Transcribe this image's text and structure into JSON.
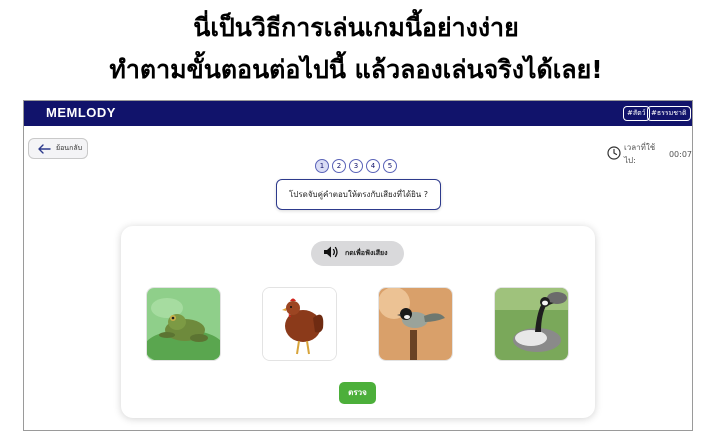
{
  "headline": {
    "line1": "นี่เป็นวิธีการเล่นเกมนี้อย่างง่าย",
    "line2": "ทำตามขั้นตอนต่อไปนี้ แล้วลองเล่นจริงได้เลย!"
  },
  "app": {
    "logo": "MEMLODY",
    "tags": [
      "#สัตว์",
      "#ธรรมชาติ"
    ]
  },
  "back_button": {
    "label": "ย้อนกลับ"
  },
  "timer": {
    "label": "เวลาที่ใช้ไป:",
    "value": "00:07"
  },
  "steps": [
    "1",
    "2",
    "3",
    "4",
    "5"
  ],
  "current_step": 1,
  "question": "โปรดจับคู่คำตอบให้ตรงกับเสียงที่ได้ยิน ?",
  "listen_button": {
    "label": "กดเพื่อฟังเสียง"
  },
  "choices": [
    {
      "name": "frog",
      "icon": "frog-image"
    },
    {
      "name": "hen",
      "icon": "hen-image"
    },
    {
      "name": "bird",
      "icon": "bird-image"
    },
    {
      "name": "goose",
      "icon": "goose-image"
    }
  ],
  "check_button": {
    "label": "ตรวจ"
  },
  "colors": {
    "navbar": "#11136b",
    "accent": "#4caf3a",
    "outline": "#2d3a8c"
  }
}
